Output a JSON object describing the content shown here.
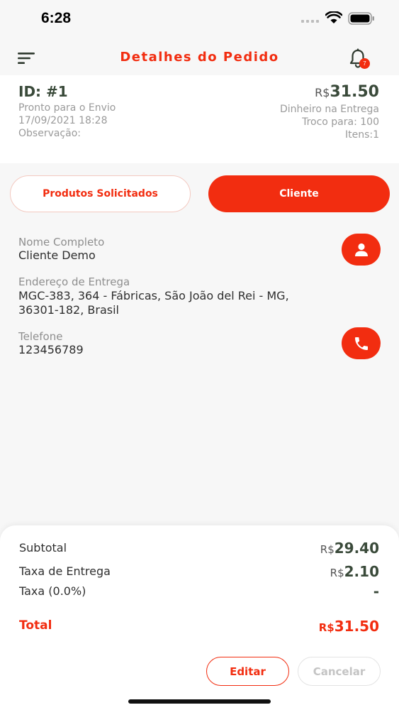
{
  "status_bar": {
    "time": "6:28"
  },
  "header": {
    "title": "Detalhes do Pedido",
    "notification_count": "7"
  },
  "order": {
    "id": "ID: #1",
    "status": "Pronto para o Envio",
    "datetime": "17/09/2021 18:28",
    "observation_label": "Observação:",
    "currency": "R$",
    "total": "31.50",
    "payment_method": "Dinheiro na Entrega",
    "change_for": "Troco para: 100",
    "items": "Itens:1"
  },
  "tabs": [
    {
      "label": "Produtos Solicitados",
      "active": false
    },
    {
      "label": "Cliente",
      "active": true
    }
  ],
  "client": {
    "name_label": "Nome Completo",
    "name": "Cliente Demo",
    "address_label": "Endereço de Entrega",
    "address_line1": "MGC-383, 364 - Fábricas, São João del Rei - MG,",
    "address_line2": "36301-182, Brasil",
    "phone_label": "Telefone",
    "phone": "123456789"
  },
  "summary": {
    "currency": "R$",
    "subtotal_label": "Subtotal",
    "subtotal": "29.40",
    "delivery_label": "Taxa de Entrega",
    "delivery": "2.10",
    "tax_label": "Taxa (0.0%)",
    "tax": "-",
    "total_label": "Total",
    "total": "31.50"
  },
  "actions": {
    "edit_label": "Editar",
    "cancel_label": "Cancelar"
  },
  "colors": {
    "accent": "#f22d10",
    "text_dark": "#3a4a3a",
    "background": "#f7f7f7"
  }
}
